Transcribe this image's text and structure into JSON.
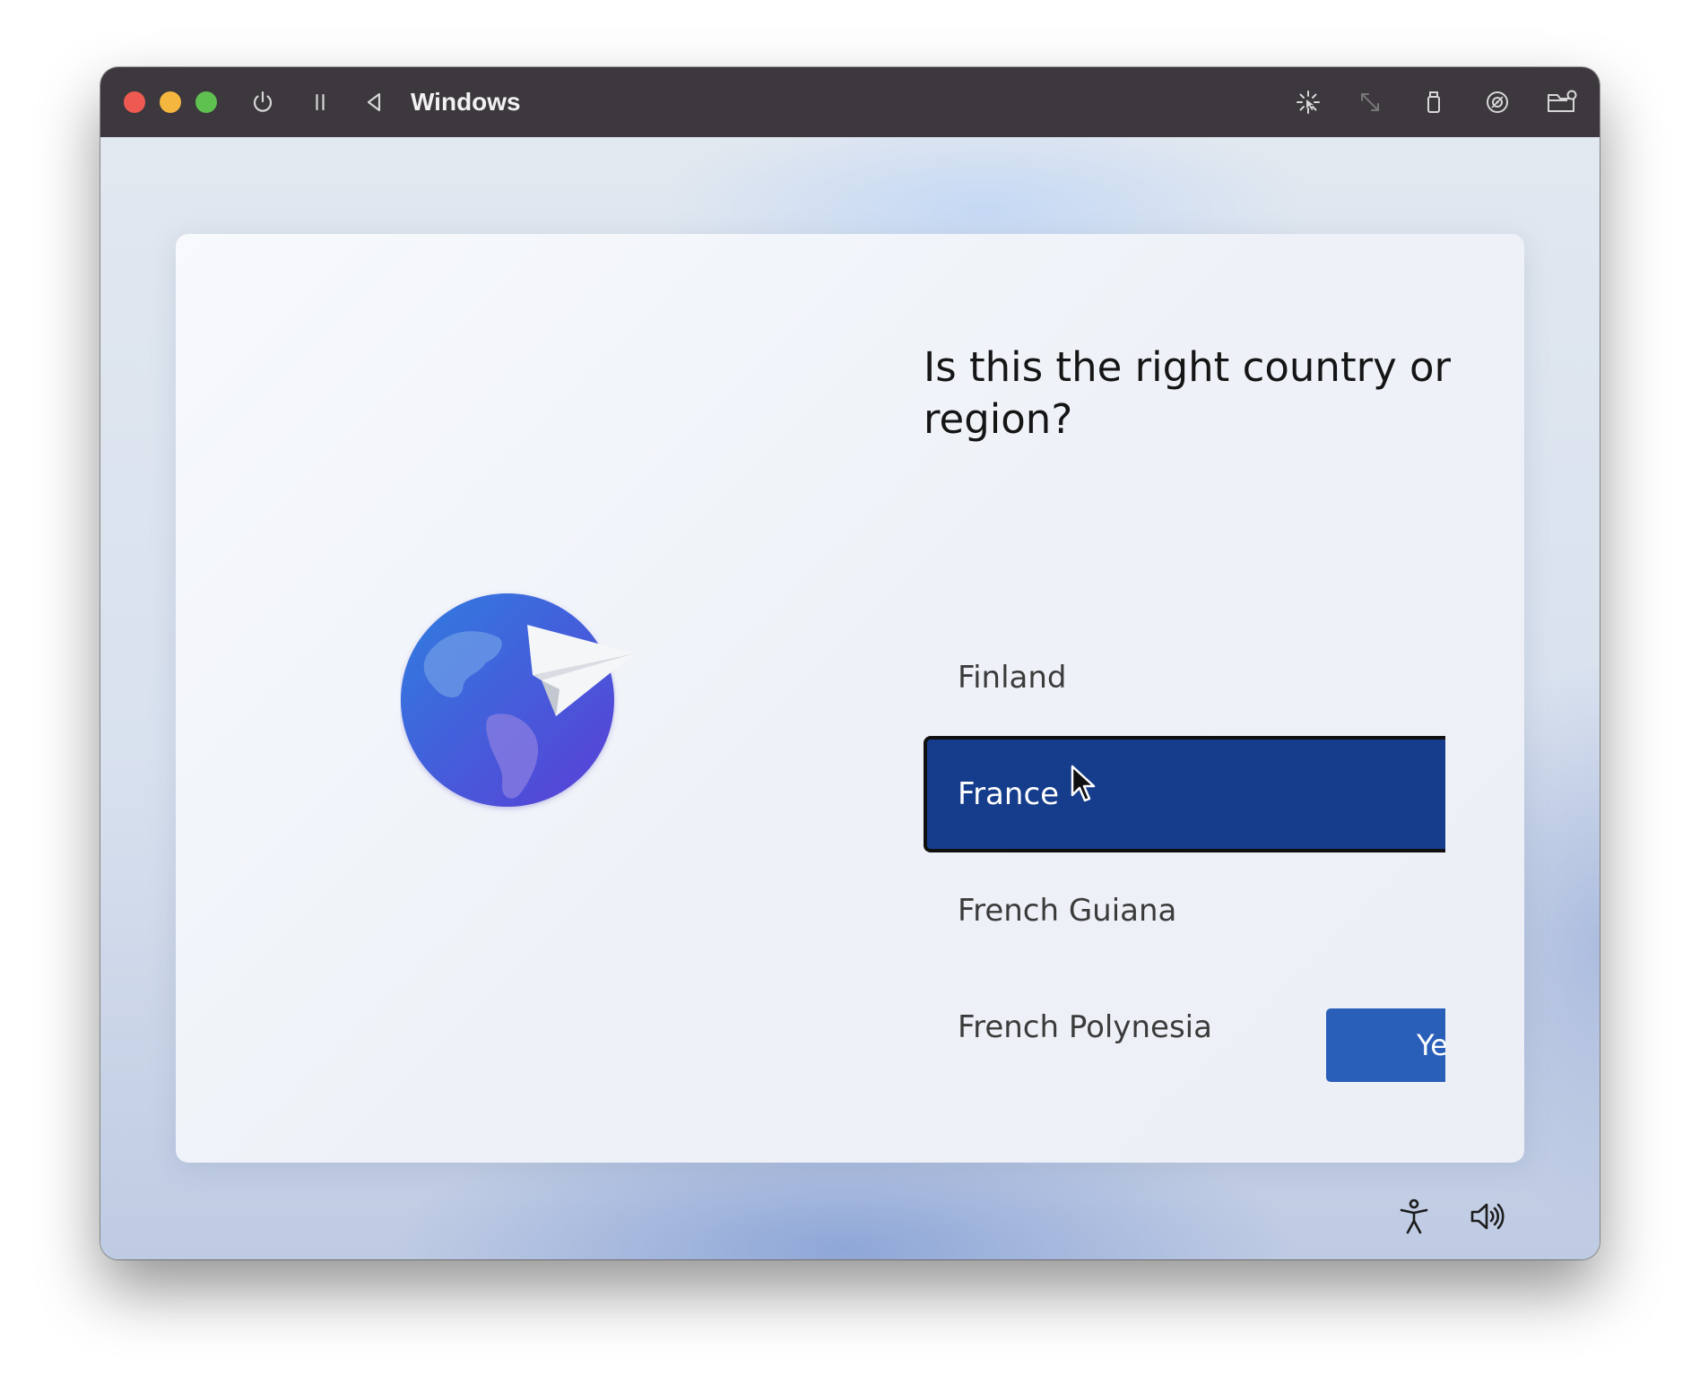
{
  "window": {
    "title": "Windows",
    "titlebar_icons": [
      "power-icon",
      "pause-icon",
      "back-icon",
      "capture-cursor-icon",
      "resize-icon",
      "usb-icon",
      "disc-icon",
      "shared-folder-icon"
    ]
  },
  "setup": {
    "question": "Is this the right country or region?",
    "countries": [
      {
        "label": "Finland",
        "selected": false
      },
      {
        "label": "France",
        "selected": true
      },
      {
        "label": "French Guiana",
        "selected": false
      },
      {
        "label": "French Polynesia",
        "selected": false
      }
    ],
    "yes_button": "Ye"
  },
  "bottom_icons": [
    "accessibility-icon",
    "volume-icon"
  ],
  "colors": {
    "selected_item": "#163d8b",
    "primary_button": "#2a5fb9",
    "titlebar": "#3c383d"
  }
}
